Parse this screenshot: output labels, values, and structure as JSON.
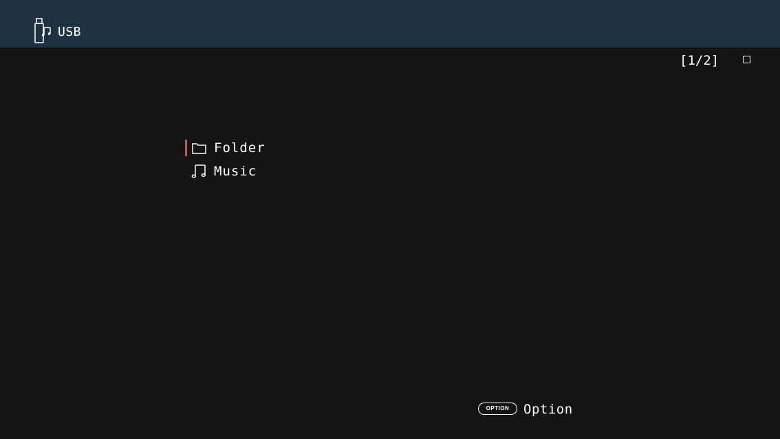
{
  "header": {
    "source_icon": "usb-music-icon",
    "source_label": "USB"
  },
  "status": {
    "page_indicator": "[1/2]",
    "status_icon": "empty-square-icon"
  },
  "menu": {
    "items": [
      {
        "label": "Folder",
        "icon": "folder-icon",
        "selected": true
      },
      {
        "label": "Music",
        "icon": "music-note-icon",
        "selected": false
      }
    ]
  },
  "footer": {
    "option_key": "OPTION",
    "option_label": "Option"
  },
  "colors": {
    "header_bg": "#1f3242",
    "page_bg": "#141414",
    "cursor_accent": "#e0502e",
    "text": "#ffffff"
  }
}
